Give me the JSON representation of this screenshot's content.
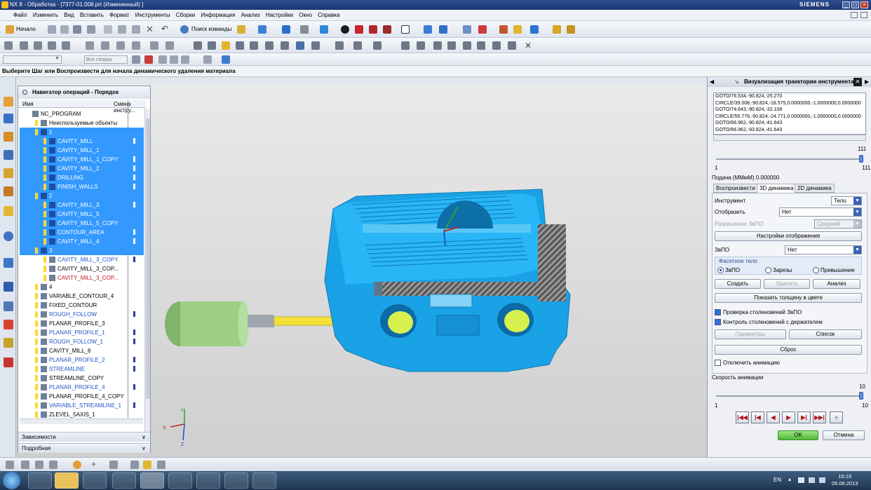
{
  "window": {
    "title": "NX 8 - Обработка - [7377-01.008.prt (Измененный) ]",
    "brand": "SIEMENS"
  },
  "menu": [
    "Файл",
    "Изменить",
    "Вид",
    "Вставить",
    "Формат",
    "Инструменты",
    "Сборки",
    "Информация",
    "Анализ",
    "Настройки",
    "Окно",
    "Справка"
  ],
  "toolbar": {
    "start_label": "Начало",
    "command_search_label": "Поиск команды",
    "selection_filter_placeholder": "Вся сборка"
  },
  "cue_line": "Выберите Шаг или Воспроизвести для начала динамического удаления материала",
  "navigator": {
    "title": "Навигатор операций - Порядок программы",
    "col_name": "Имя",
    "col_tool_change": "Смена инстру...",
    "rows": [
      {
        "label": "NC_PROGRAM",
        "indent": 0,
        "selected": false,
        "color": "black",
        "marker": false
      },
      {
        "label": "Неиспользуемые объекты",
        "indent": 1,
        "selected": false,
        "color": "black",
        "marker": false
      },
      {
        "label": "1",
        "indent": 1,
        "selected": true,
        "color": "white",
        "marker": false
      },
      {
        "label": "CAVITY_MILL",
        "indent": 2,
        "selected": true,
        "color": "white",
        "marker": true
      },
      {
        "label": "CAVITY_MILL_1",
        "indent": 2,
        "selected": true,
        "color": "white",
        "marker": false
      },
      {
        "label": "CAVITY_MILL_1_COPY",
        "indent": 2,
        "selected": true,
        "color": "white",
        "marker": true
      },
      {
        "label": "CAVITY_MILL_2",
        "indent": 2,
        "selected": true,
        "color": "white",
        "marker": true
      },
      {
        "label": "DRILLING",
        "indent": 2,
        "selected": true,
        "color": "white",
        "marker": true
      },
      {
        "label": "FINISH_WALLS",
        "indent": 2,
        "selected": true,
        "color": "white",
        "marker": true
      },
      {
        "label": "2",
        "indent": 1,
        "selected": true,
        "color": "white",
        "marker": false
      },
      {
        "label": "CAVITY_MILL_3",
        "indent": 2,
        "selected": true,
        "color": "white",
        "marker": true
      },
      {
        "label": "CAVITY_MILL_5",
        "indent": 2,
        "selected": true,
        "color": "white",
        "marker": false
      },
      {
        "label": "CAVITY_MILL_5_COPY",
        "indent": 2,
        "selected": true,
        "color": "white",
        "marker": false
      },
      {
        "label": "CONTOUR_AREA",
        "indent": 2,
        "selected": true,
        "color": "white",
        "marker": true
      },
      {
        "label": "CAVITY_MILL_4",
        "indent": 2,
        "selected": true,
        "color": "white",
        "marker": true
      },
      {
        "label": "3",
        "indent": 1,
        "selected": true,
        "color": "white",
        "marker": false
      },
      {
        "label": "CAVITY_MILL_3_COPY",
        "indent": 2,
        "selected": false,
        "color": "blue",
        "marker": true
      },
      {
        "label": "CAVITY_MILL_3_COP...",
        "indent": 2,
        "selected": false,
        "color": "black",
        "marker": false
      },
      {
        "label": "CAVITY_MILL_3_COP...",
        "indent": 2,
        "selected": false,
        "color": "red",
        "marker": false
      },
      {
        "label": "4",
        "indent": 1,
        "selected": false,
        "color": "black",
        "marker": false
      },
      {
        "label": "VARIABLE_CONTOUR_4",
        "indent": 1,
        "selected": false,
        "color": "black",
        "marker": false
      },
      {
        "label": "FIXED_CONTOUR",
        "indent": 1,
        "selected": false,
        "color": "black",
        "marker": false
      },
      {
        "label": "ROUGH_FOLLOW",
        "indent": 1,
        "selected": false,
        "color": "blue",
        "marker": true
      },
      {
        "label": "PLANAR_PROFILE_3",
        "indent": 1,
        "selected": false,
        "color": "black",
        "marker": false
      },
      {
        "label": "PLANAR_PROFILE_1",
        "indent": 1,
        "selected": false,
        "color": "blue",
        "marker": true
      },
      {
        "label": "ROUGH_FOLLOW_1",
        "indent": 1,
        "selected": false,
        "color": "blue",
        "marker": true
      },
      {
        "label": "CAVITY_MILL_6",
        "indent": 1,
        "selected": false,
        "color": "black",
        "marker": false
      },
      {
        "label": "PLANAR_PROFILE_2",
        "indent": 1,
        "selected": false,
        "color": "blue",
        "marker": true
      },
      {
        "label": "STREAMLINE",
        "indent": 1,
        "selected": false,
        "color": "blue",
        "marker": true
      },
      {
        "label": "STREAMLINE_COPY",
        "indent": 1,
        "selected": false,
        "color": "black",
        "marker": false
      },
      {
        "label": "PLANAR_PROFILE_4",
        "indent": 1,
        "selected": false,
        "color": "blue",
        "marker": true
      },
      {
        "label": "PLANAR_PROFILE_4_COPY",
        "indent": 1,
        "selected": false,
        "color": "black",
        "marker": false
      },
      {
        "label": "VARIABLE_STREAMLINE_1",
        "indent": 1,
        "selected": false,
        "color": "blue",
        "marker": true
      },
      {
        "label": "ZLEVEL_5AXIS_1",
        "indent": 1,
        "selected": false,
        "color": "black",
        "marker": false
      }
    ],
    "panel_dependencies": "Зависимости",
    "panel_details": "Подробная"
  },
  "dialog": {
    "title": "Визуализация траектории инструмента",
    "code_lines": [
      "GOTO/76.534,-90.824,-25.270",
      "CIRCLE/39.008,-90.824,-18.575,0.0000000,-1.0000000,0.0000000",
      "GOTO/74.643,-90.824,-32.108",
      "CIRCLE/55.776,-90.824,-24.771,0.0000000,-1.0000000,0.0000000",
      "GOTO/66.962,-90.824,-41.643",
      "GOTO/66.962,-93.824,-41.643"
    ],
    "progress_max_label": "111",
    "progress_min_label": "1",
    "progress_right_label": "111",
    "progress_fraction": 1.0,
    "feed_label": "Подача (ММмМ) 0.000000",
    "tabs": [
      "Воспроизвести",
      "3D динамика",
      "2D динамика"
    ],
    "active_tab": 1,
    "tool_label": "Инструмент",
    "tool_value": "Тело",
    "display_label": "Отобразить",
    "display_value": "Нет",
    "ipw_res_label": "Разрешение ЗвПО",
    "ipw_res_value": "Средний",
    "display_settings_button": "Настройки отображения",
    "ipw_label": "ЗвПО",
    "ipw_value": "Нет",
    "faceted_group_label": "Фасетное тело",
    "radio_ipw": "ЗвПО",
    "radio_gouges": "Зарезы",
    "radio_excess": "Превышение",
    "create_button": "Создать",
    "delete_button": "Удалить",
    "analysis_button": "Анализ",
    "thickness_button": "Показать толщину в цвете",
    "check_collision_ipw": "Проверка столкновений ЗвПО",
    "check_collision_holder": "Контроль столкновений с держателем",
    "params_button": "Параметры",
    "list_button": "Список",
    "reset_button": "Сброс",
    "disable_animation": "Отключить анимацию",
    "anim_speed_label": "Скорость анимации",
    "anim_speed_max": "10",
    "anim_speed_min": "1",
    "anim_speed_right": "10",
    "anim_speed_fraction": 1.0,
    "vcr_icons": [
      "rewind-to-start-icon",
      "step-back-icon",
      "play-backward-icon",
      "play-forward-icon",
      "step-forward-icon",
      "fast-forward-icon",
      "stop-icon"
    ],
    "ok_button": "OK",
    "cancel_button": "Отмена"
  },
  "triad": {
    "x": "X",
    "y": "Y",
    "z": "Z"
  },
  "taskbar": {
    "lang": "EN",
    "time": "16:15",
    "date": "05.06.2013"
  },
  "colors": {
    "part_cyan": "#29b6f6",
    "selection_blue": "#3399ff",
    "ok_green": "#6fd45a",
    "holder_green": "#9ccf84",
    "shank_yellow": "#f4e23a"
  }
}
